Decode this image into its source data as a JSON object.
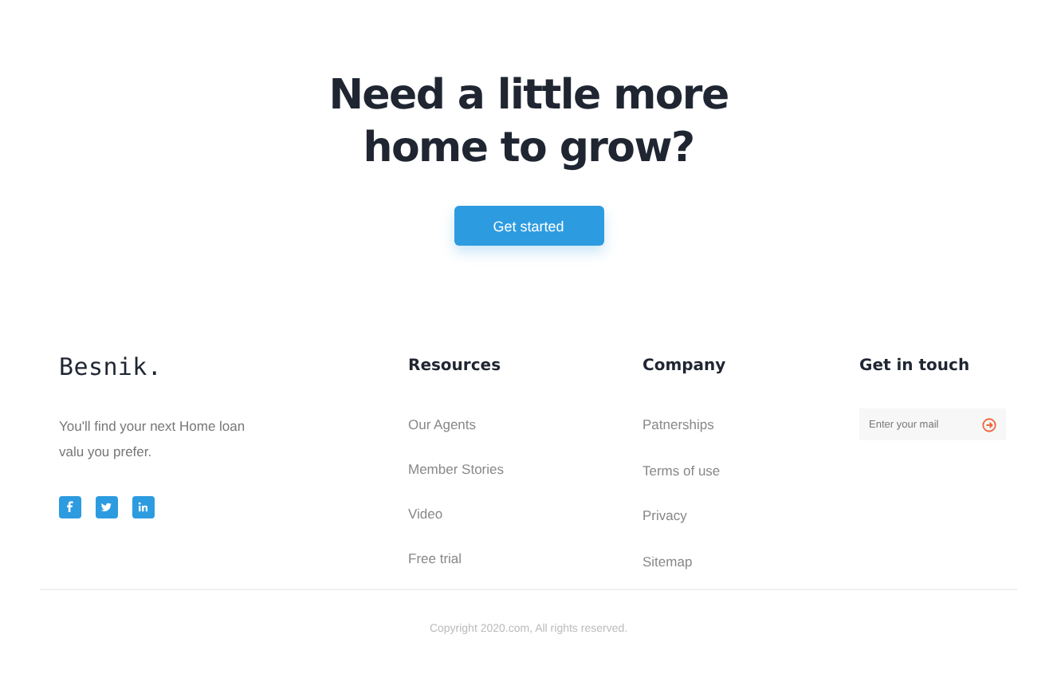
{
  "hero": {
    "title": "Need a little more home to grow?",
    "button": "Get started"
  },
  "footer": {
    "brand": {
      "logo": "Besnik.",
      "tagline": "You'll find your next Home loan valu you prefer.",
      "social": [
        {
          "kind": "facebook"
        },
        {
          "kind": "twitter"
        },
        {
          "kind": "linkedin"
        }
      ]
    },
    "columns": [
      {
        "heading": "Resources",
        "links": [
          "Our Agents",
          "Member Stories",
          "Video",
          "Free trial"
        ]
      },
      {
        "heading": "Company",
        "links": [
          "Patnerships",
          "Terms of use",
          "Privacy",
          "Sitemap"
        ]
      }
    ],
    "contact": {
      "heading": "Get in touch",
      "email": {
        "placeholder": "Enter your mail"
      }
    },
    "copyright": "Copyright 2020.com, All rights reserved."
  }
}
